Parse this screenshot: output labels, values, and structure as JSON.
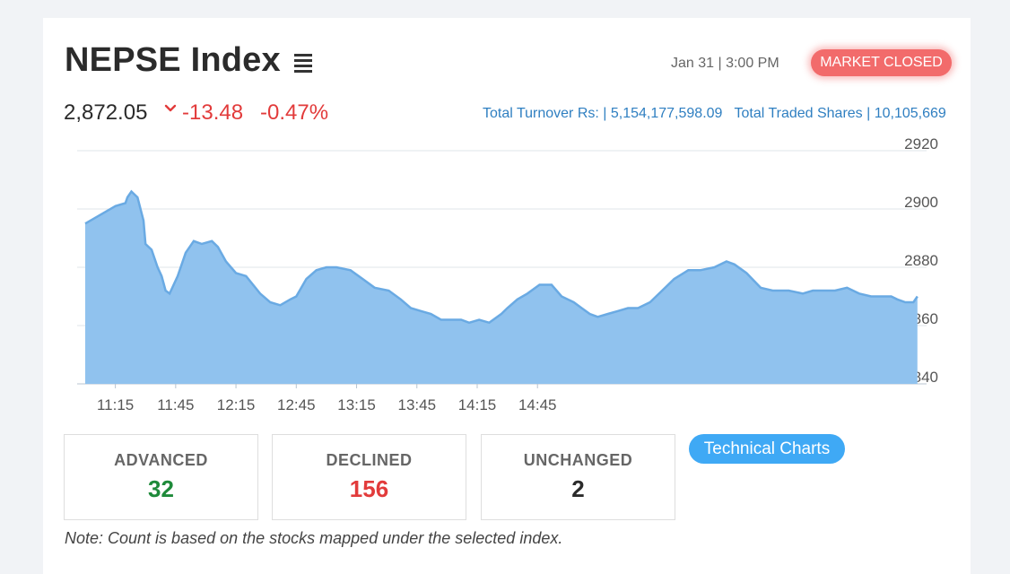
{
  "header": {
    "title": "NEPSE Index",
    "menu_icon": "hamburger-list-icon",
    "datetime": "Jan 31 | 3:00 PM",
    "market_status": "MARKET CLOSED"
  },
  "quote": {
    "price": "2,872.05",
    "direction_icon": "chevron-down-icon",
    "change": "-13.48",
    "change_pct": "-0.47%",
    "turnover_text": "Total Turnover Rs: | 5,154,177,598.09   Total Traded Shares | 10,105,669"
  },
  "colors": {
    "area_fill": "#90c2ee",
    "area_line": "#6aaae3",
    "negative": "#e23b3b",
    "positive": "#1e8a3a",
    "badge": "#f26b6b",
    "accent": "#3fa9f5"
  },
  "chart_data": {
    "type": "area",
    "x_ticks": [
      "11:15",
      "11:45",
      "12:15",
      "12:45",
      "13:15",
      "13:45",
      "14:15",
      "14:45"
    ],
    "y_ticks": [
      "2920",
      "2900",
      "2880",
      "2860",
      "2840"
    ],
    "ylim": [
      2840,
      2920
    ],
    "xlim_minutes_from_11_00": [
      0,
      250
    ],
    "grid": true,
    "series": [
      {
        "values": [
          [
            0,
            2895
          ],
          [
            10,
            2899
          ],
          [
            15,
            2901
          ],
          [
            20,
            2902
          ],
          [
            21,
            2904
          ],
          [
            23,
            2906
          ],
          [
            26,
            2904
          ],
          [
            29,
            2896
          ],
          [
            30,
            2888
          ],
          [
            33,
            2886
          ],
          [
            36,
            2880
          ],
          [
            38,
            2877
          ],
          [
            40,
            2872
          ],
          [
            42,
            2871
          ],
          [
            46,
            2877
          ],
          [
            50,
            2885
          ],
          [
            54,
            2889
          ],
          [
            58,
            2888
          ],
          [
            63,
            2889
          ],
          [
            66,
            2887
          ],
          [
            70,
            2882
          ],
          [
            75,
            2878
          ],
          [
            80,
            2877
          ],
          [
            87,
            2871
          ],
          [
            92,
            2868
          ],
          [
            97,
            2867
          ],
          [
            102,
            2869
          ],
          [
            105,
            2870
          ],
          [
            110,
            2876
          ],
          [
            115,
            2879
          ],
          [
            120,
            2880
          ],
          [
            125,
            2880
          ],
          [
            132,
            2879
          ],
          [
            138,
            2876
          ],
          [
            144,
            2873
          ],
          [
            151,
            2872
          ],
          [
            157,
            2869
          ],
          [
            162,
            2866
          ],
          [
            167,
            2865
          ],
          [
            172,
            2864
          ],
          [
            177,
            2862
          ],
          [
            182,
            2862
          ],
          [
            187,
            2862
          ],
          [
            191,
            2861
          ],
          [
            196,
            2862
          ],
          [
            201,
            2861
          ],
          [
            207,
            2864
          ],
          [
            210,
            2866
          ],
          [
            215,
            2869
          ],
          [
            220,
            2871
          ],
          [
            226,
            2874
          ],
          [
            232,
            2874
          ],
          [
            237,
            2870
          ],
          [
            243,
            2868
          ],
          [
            247,
            2866
          ],
          [
            251,
            2864
          ],
          [
            255,
            2863
          ],
          [
            260,
            2864
          ],
          [
            265,
            2865
          ],
          [
            270,
            2866
          ],
          [
            275,
            2866
          ],
          [
            281,
            2868
          ],
          [
            287,
            2872
          ],
          [
            293,
            2876
          ],
          [
            300,
            2879
          ],
          [
            306,
            2879
          ],
          [
            313,
            2880
          ],
          [
            319,
            2882
          ],
          [
            323,
            2881
          ],
          [
            329,
            2878
          ],
          [
            336,
            2873
          ],
          [
            342,
            2872
          ],
          [
            350,
            2872
          ],
          [
            357,
            2871
          ],
          [
            362,
            2872
          ],
          [
            368,
            2872
          ],
          [
            373,
            2872
          ],
          [
            379,
            2873
          ],
          [
            385,
            2871
          ],
          [
            391,
            2870
          ],
          [
            397,
            2870
          ],
          [
            401,
            2870
          ],
          [
            404,
            2869
          ],
          [
            408,
            2868
          ],
          [
            412,
            2868
          ],
          [
            414,
            2870
          ]
        ]
      }
    ]
  },
  "stats": {
    "advanced_label": "ADVANCED",
    "advanced_value": "32",
    "declined_label": "DECLINED",
    "declined_value": "156",
    "unchanged_label": "UNCHANGED",
    "unchanged_value": "2"
  },
  "actions": {
    "technical_charts": "Technical Charts"
  },
  "note": "Note: Count is based on the stocks mapped under the selected index."
}
